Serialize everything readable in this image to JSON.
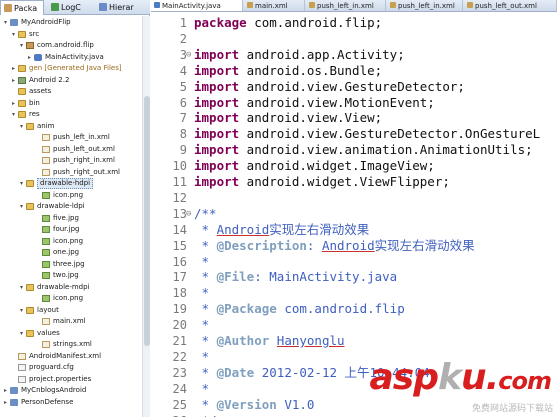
{
  "left_tabs": [
    {
      "label": "Packa",
      "icon": "package-explorer-icon"
    },
    {
      "label": "LogC",
      "icon": "logcat-icon"
    },
    {
      "label": "Hierar",
      "icon": "hierarchy-icon"
    }
  ],
  "tree": [
    {
      "label": "MyAndroidFlip",
      "twisty": "▾",
      "icon": "project",
      "style": ""
    },
    {
      "label": "src",
      "twisty": "▾",
      "icon": "folder",
      "style": ""
    },
    {
      "label": "com.android.flip",
      "twisty": "▾",
      "icon": "package",
      "style": ""
    },
    {
      "label": "MainActivity.java",
      "twisty": "▸",
      "icon": "java",
      "style": ""
    },
    {
      "label": "gen [Generated Java Files]",
      "twisty": "▸",
      "icon": "folder",
      "style": "gen"
    },
    {
      "label": "Android 2.2",
      "twisty": "▸",
      "icon": "lib",
      "style": ""
    },
    {
      "label": "assets",
      "twisty": "",
      "icon": "folder",
      "style": ""
    },
    {
      "label": "bin",
      "twisty": "▸",
      "icon": "folder",
      "style": ""
    },
    {
      "label": "res",
      "twisty": "▾",
      "icon": "folder",
      "style": ""
    },
    {
      "label": "anim",
      "twisty": "▾",
      "icon": "folder",
      "style": ""
    },
    {
      "label": "push_left_in.xml",
      "twisty": "",
      "icon": "xml",
      "style": ""
    },
    {
      "label": "push_left_out.xml",
      "twisty": "",
      "icon": "xml",
      "style": ""
    },
    {
      "label": "push_right_in.xml",
      "twisty": "",
      "icon": "xml",
      "style": ""
    },
    {
      "label": "push_right_out.xml",
      "twisty": "",
      "icon": "xml",
      "style": ""
    },
    {
      "label": "drawable-hdpi",
      "twisty": "▾",
      "icon": "folder",
      "style": "sel"
    },
    {
      "label": "icon.png",
      "twisty": "",
      "icon": "img",
      "style": ""
    },
    {
      "label": "drawable-ldpi",
      "twisty": "▾",
      "icon": "folder",
      "style": ""
    },
    {
      "label": "five.jpg",
      "twisty": "",
      "icon": "img",
      "style": ""
    },
    {
      "label": "four.jpg",
      "twisty": "",
      "icon": "img",
      "style": ""
    },
    {
      "label": "icon.png",
      "twisty": "",
      "icon": "img",
      "style": ""
    },
    {
      "label": "one.jpg",
      "twisty": "",
      "icon": "img",
      "style": ""
    },
    {
      "label": "three.jpg",
      "twisty": "",
      "icon": "img",
      "style": ""
    },
    {
      "label": "two.jpg",
      "twisty": "",
      "icon": "img",
      "style": ""
    },
    {
      "label": "drawable-mdpi",
      "twisty": "▾",
      "icon": "folder",
      "style": ""
    },
    {
      "label": "icon.png",
      "twisty": "",
      "icon": "img",
      "style": ""
    },
    {
      "label": "layout",
      "twisty": "▾",
      "icon": "folder",
      "style": ""
    },
    {
      "label": "main.xml",
      "twisty": "",
      "icon": "xml",
      "style": ""
    },
    {
      "label": "values",
      "twisty": "▾",
      "icon": "folder",
      "style": ""
    },
    {
      "label": "strings.xml",
      "twisty": "",
      "icon": "xml",
      "style": ""
    },
    {
      "label": "AndroidManifest.xml",
      "twisty": "",
      "icon": "xml",
      "style": ""
    },
    {
      "label": "proguard.cfg",
      "twisty": "",
      "icon": "file",
      "style": ""
    },
    {
      "label": "project.properties",
      "twisty": "",
      "icon": "file",
      "style": ""
    },
    {
      "label": "MyCnblogsAndroid",
      "twisty": "▸",
      "icon": "project",
      "style": ""
    },
    {
      "label": "PersonDefense",
      "twisty": "▸",
      "icon": "project",
      "style": ""
    }
  ],
  "editor_tabs": [
    {
      "label": "MainActivity.java",
      "icon": "java-file-icon",
      "active": true
    },
    {
      "label": "main.xml",
      "icon": "xml-file-icon",
      "active": false
    },
    {
      "label": "push_left_in.xml",
      "icon": "xml-file-icon",
      "active": false
    },
    {
      "label": "push_left_in.xml",
      "icon": "xml-file-icon",
      "active": false
    },
    {
      "label": "push_left_out.xml",
      "icon": "xml-file-icon",
      "active": false
    }
  ],
  "code_lines": [
    {
      "num": "1",
      "fold": "",
      "tokens": [
        {
          "t": "package",
          "c": "kw"
        },
        {
          "t": " com.android.flip;",
          "c": ""
        }
      ]
    },
    {
      "num": "2",
      "fold": "",
      "tokens": []
    },
    {
      "num": "3",
      "fold": "⊖",
      "tokens": [
        {
          "t": "import",
          "c": "kw"
        },
        {
          "t": " android.app.Activity;",
          "c": ""
        }
      ]
    },
    {
      "num": "4",
      "fold": "",
      "tokens": [
        {
          "t": "import",
          "c": "kw"
        },
        {
          "t": " android.os.Bundle;",
          "c": ""
        }
      ]
    },
    {
      "num": "5",
      "fold": "",
      "tokens": [
        {
          "t": "import",
          "c": "kw"
        },
        {
          "t": " android.view.GestureDetector;",
          "c": ""
        }
      ]
    },
    {
      "num": "6",
      "fold": "",
      "tokens": [
        {
          "t": "import",
          "c": "kw"
        },
        {
          "t": " android.view.MotionEvent;",
          "c": ""
        }
      ]
    },
    {
      "num": "7",
      "fold": "",
      "tokens": [
        {
          "t": "import",
          "c": "kw"
        },
        {
          "t": " android.view.View;",
          "c": ""
        }
      ]
    },
    {
      "num": "8",
      "fold": "",
      "tokens": [
        {
          "t": "import",
          "c": "kw"
        },
        {
          "t": " android.view.GestureDetector.OnGestureL",
          "c": ""
        }
      ]
    },
    {
      "num": "9",
      "fold": "",
      "tokens": [
        {
          "t": "import",
          "c": "kw"
        },
        {
          "t": " android.view.animation.AnimationUtils;",
          "c": ""
        }
      ]
    },
    {
      "num": "10",
      "fold": "",
      "tokens": [
        {
          "t": "import",
          "c": "kw"
        },
        {
          "t": " android.widget.ImageView;",
          "c": ""
        }
      ]
    },
    {
      "num": "11",
      "fold": "",
      "tokens": [
        {
          "t": "import",
          "c": "kw"
        },
        {
          "t": " android.widget.ViewFlipper;",
          "c": ""
        }
      ]
    },
    {
      "num": "12",
      "fold": "",
      "tokens": []
    },
    {
      "num": "13",
      "fold": "⊖",
      "tokens": [
        {
          "t": "/**",
          "c": "cm"
        }
      ]
    },
    {
      "num": "14",
      "fold": "",
      "tokens": [
        {
          "t": " * ",
          "c": "cm"
        },
        {
          "t": "Android",
          "c": "ul"
        },
        {
          "t": "实现左右滑动效果",
          "c": "cm"
        }
      ]
    },
    {
      "num": "15",
      "fold": "",
      "tokens": [
        {
          "t": " * ",
          "c": "cm"
        },
        {
          "t": "@Description",
          "c": "tag"
        },
        {
          "t": ": ",
          "c": "cm"
        },
        {
          "t": "Android",
          "c": "ul"
        },
        {
          "t": "实现左右滑动效果",
          "c": "cm"
        }
      ]
    },
    {
      "num": "16",
      "fold": "",
      "tokens": [
        {
          "t": " *",
          "c": "cm"
        }
      ]
    },
    {
      "num": "17",
      "fold": "",
      "tokens": [
        {
          "t": " * ",
          "c": "cm"
        },
        {
          "t": "@File",
          "c": "tag"
        },
        {
          "t": ": MainActivity.java",
          "c": "cm"
        }
      ]
    },
    {
      "num": "18",
      "fold": "",
      "tokens": [
        {
          "t": " *",
          "c": "cm"
        }
      ]
    },
    {
      "num": "19",
      "fold": "",
      "tokens": [
        {
          "t": " * ",
          "c": "cm"
        },
        {
          "t": "@Package",
          "c": "tag"
        },
        {
          "t": " com.android.flip",
          "c": "cm"
        }
      ]
    },
    {
      "num": "20",
      "fold": "",
      "tokens": [
        {
          "t": " *",
          "c": "cm"
        }
      ]
    },
    {
      "num": "21",
      "fold": "",
      "tokens": [
        {
          "t": " * ",
          "c": "cm"
        },
        {
          "t": "@Author",
          "c": "tag"
        },
        {
          "t": " ",
          "c": "cm"
        },
        {
          "t": "Hanyonglu",
          "c": "ul"
        }
      ]
    },
    {
      "num": "22",
      "fold": "",
      "tokens": [
        {
          "t": " *",
          "c": "cm"
        }
      ]
    },
    {
      "num": "23",
      "fold": "",
      "tokens": [
        {
          "t": " * ",
          "c": "cm"
        },
        {
          "t": "@Date",
          "c": "tag"
        },
        {
          "t": " 2012-02-12 上午10:44:04",
          "c": "cm"
        }
      ]
    },
    {
      "num": "24",
      "fold": "",
      "tokens": [
        {
          "t": " *",
          "c": "cm"
        }
      ]
    },
    {
      "num": "25",
      "fold": "",
      "tokens": [
        {
          "t": " * ",
          "c": "cm"
        },
        {
          "t": "@Version",
          "c": "tag"
        },
        {
          "t": " V1.0",
          "c": "cm"
        }
      ]
    },
    {
      "num": "26",
      "fold": "",
      "tokens": [
        {
          "t": " */",
          "c": "cm"
        }
      ]
    }
  ],
  "watermark": {
    "brand_a": "asp",
    "brand_k": "k",
    "brand_u": "u",
    "brand_dot": ".",
    "brand_b": "com",
    "caption": "免费网站源码下载站"
  },
  "colors": {
    "keyword": "#7f0055",
    "comment": "#3f5fbf",
    "javadoc_tag": "#7f9fbf",
    "tab_gradient_top": "#e6eef8",
    "tab_gradient_bottom": "#cfdcec",
    "watermark_red": "#d81e1e"
  }
}
